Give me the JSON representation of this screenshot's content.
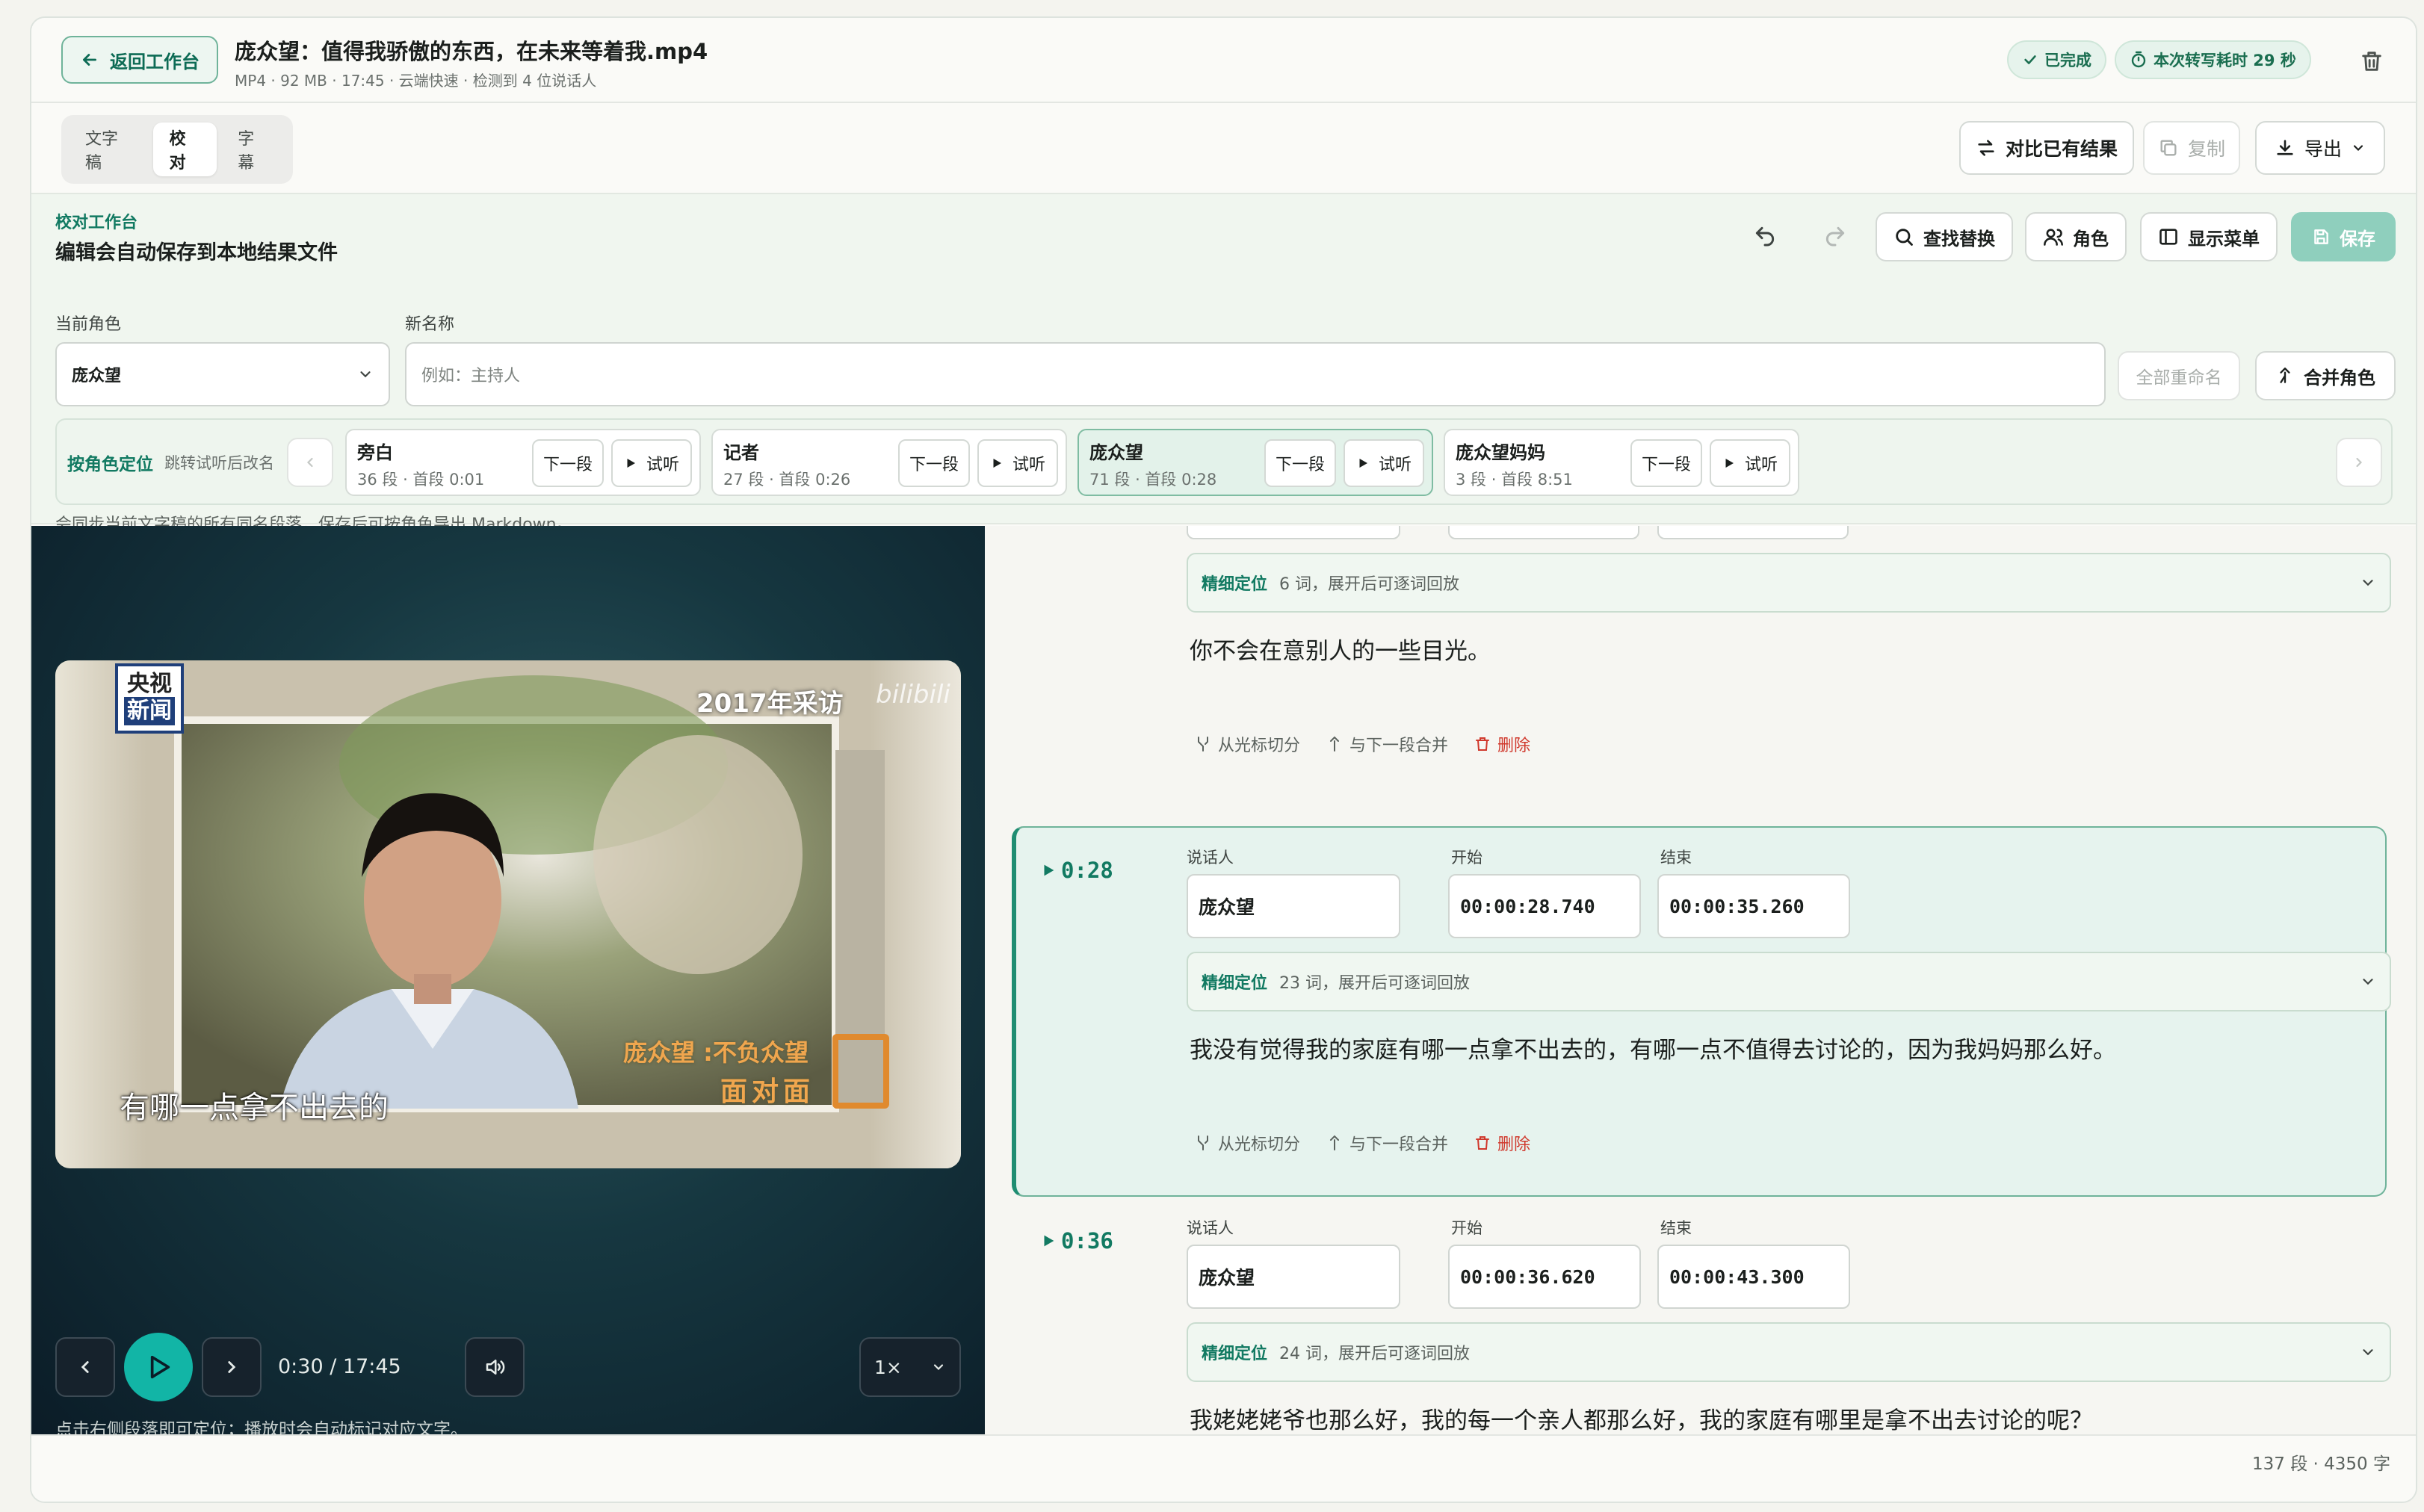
{
  "header": {
    "back_label": "返回工作台",
    "file_title": "庞众望：值得我骄傲的东西，在未来等着我.mp4",
    "file_meta": "MP4 · 92 MB · 17:45 · 云端快速 · 检测到 4 位说话人",
    "status_badge": "已完成",
    "time_badge": "本次转写耗时 29 秒"
  },
  "tabs": [
    {
      "label": "文字稿"
    },
    {
      "label": "校对"
    },
    {
      "label": "字幕"
    }
  ],
  "toolbar": {
    "compare_label": "对比已有结果",
    "copy_label": "复制",
    "export_label": "导出"
  },
  "proof": {
    "eyebrow": "校对工作台",
    "title": "编辑会自动保存到本地结果文件",
    "find_label": "查找替换",
    "roles_label": "角色",
    "menu_label": "显示菜单",
    "save_label": "保存",
    "current_role_label": "当前角色",
    "current_role_value": "庞众望",
    "new_name_label": "新名称",
    "new_name_placeholder": "例如：主持人",
    "rename_all_label": "全部重命名",
    "merge_label": "合并角色",
    "locate_label": "按角色定位",
    "locate_hint": "跳转试听后改名",
    "next_label": "下一段",
    "listen_label": "试听",
    "note": "会同步当前文字稿的所有同名段落，保存后可按角色导出 Markdown。",
    "roles": [
      {
        "name": "旁白",
        "stats": "36 段 · 首段 0:01"
      },
      {
        "name": "记者",
        "stats": "27 段 · 首段 0:26"
      },
      {
        "name": "庞众望",
        "stats": "71 段 · 首段 0:28"
      },
      {
        "name": "庞众望妈妈",
        "stats": "3 段 · 首段 8:51"
      }
    ]
  },
  "video": {
    "logo_line1": "央视",
    "logo_line2": "新闻",
    "year_caption": "2017年采访",
    "watermark": "bilibili",
    "name_caption": "庞众望 :不负众望",
    "show_caption": "面对面",
    "subtitle": "有哪一点拿不出去的",
    "time": "0:30 / 17:45",
    "speed": "1×",
    "hint": "点击右侧段落即可定位；播放时会自动标记对应文字。"
  },
  "transcript": {
    "speaker_label": "说话人",
    "start_label": "开始",
    "end_label": "结束",
    "fine_label": "精细定位",
    "split_label": "从光标切分",
    "merge_next_label": "与下一段合并",
    "delete_label": "删除",
    "prev_segment": {
      "fine_info": "6 词，展开后可逐词回放",
      "text": "你不会在意别人的一些目光。"
    },
    "segments": [
      {
        "time": "0:28",
        "speaker": "庞众望",
        "start": "00:00:28.740",
        "end": "00:00:35.260",
        "fine_info": "23 词，展开后可逐词回放",
        "text": "我没有觉得我的家庭有哪一点拿不出去的，有哪一点不值得去讨论的，因为我妈妈那么好。"
      },
      {
        "time": "0:36",
        "speaker": "庞众望",
        "start": "00:00:36.620",
        "end": "00:00:43.300",
        "fine_info": "24 词，展开后可逐词回放",
        "text": "我姥姥姥爷也那么好，我的每一个亲人都那么好，我的家庭有哪里是拿不出去讨论的呢？"
      }
    ]
  },
  "footer": {
    "stats": "137 段 · 4350 字"
  },
  "colors": {
    "accent": "#127a62",
    "accent_light": "#e6f3ee",
    "danger": "#d0382c",
    "save_button": "#8fcfbd"
  }
}
